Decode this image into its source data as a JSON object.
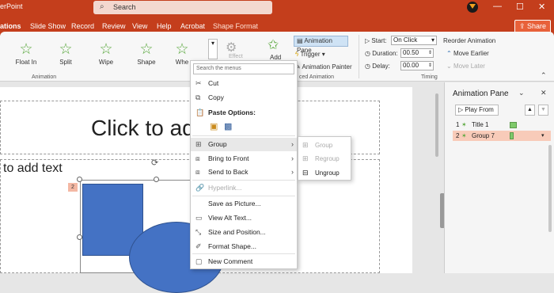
{
  "titlebar": {
    "app_name": "erPoint",
    "search_placeholder": "Search",
    "minimize": "—",
    "restore": "☐",
    "close": "✕"
  },
  "tabs": [
    {
      "label": "ations",
      "active": true
    },
    {
      "label": "Slide Show"
    },
    {
      "label": "Record"
    },
    {
      "label": "Review"
    },
    {
      "label": "View"
    },
    {
      "label": "Help"
    },
    {
      "label": "Acrobat"
    },
    {
      "label": "Shape Format",
      "accent": true
    }
  ],
  "share_label": "Share",
  "ribbon": {
    "animations": [
      "Float In",
      "Split",
      "Wipe",
      "Shape",
      "Whe"
    ],
    "effect_label": "Effect",
    "add_label": "Add",
    "group_animation_label": "Animation",
    "animation_pane_btn": "Animation Pane",
    "trigger_label": "Trigger",
    "animation_painter_label": "Animation Painter",
    "adv_group_label": "ced Animation",
    "start_label": "Start:",
    "start_value": "On Click",
    "duration_label": "Duration:",
    "duration_value": "00.50",
    "delay_label": "Delay:",
    "delay_value": "00.00",
    "reorder_label": "Reorder Animation",
    "move_earlier": "Move Earlier",
    "move_later": "Move Later",
    "timing_label": "Timing"
  },
  "slide": {
    "title_text": "Click to ad",
    "body_text": "to add text",
    "anim_badge": "2"
  },
  "context_menu": {
    "search_placeholder": "Search the menus",
    "cut": "Cut",
    "copy": "Copy",
    "paste_options": "Paste Options:",
    "group": "Group",
    "bring_to_front": "Bring to Front",
    "send_to_back": "Send to Back",
    "hyperlink": "Hyperlink...",
    "save_as_picture": "Save as Picture...",
    "view_alt_text": "View Alt Text...",
    "size_and_position": "Size and Position...",
    "format_shape": "Format Shape...",
    "new_comment": "New Comment"
  },
  "submenu": {
    "group": "Group",
    "regroup": "Regroup",
    "ungroup": "Ungroup"
  },
  "animation_pane": {
    "title": "Animation Pane",
    "play_from": "Play From",
    "items": [
      {
        "num": "1",
        "label": "Title 1"
      },
      {
        "num": "2",
        "label": "Group 7"
      }
    ]
  }
}
